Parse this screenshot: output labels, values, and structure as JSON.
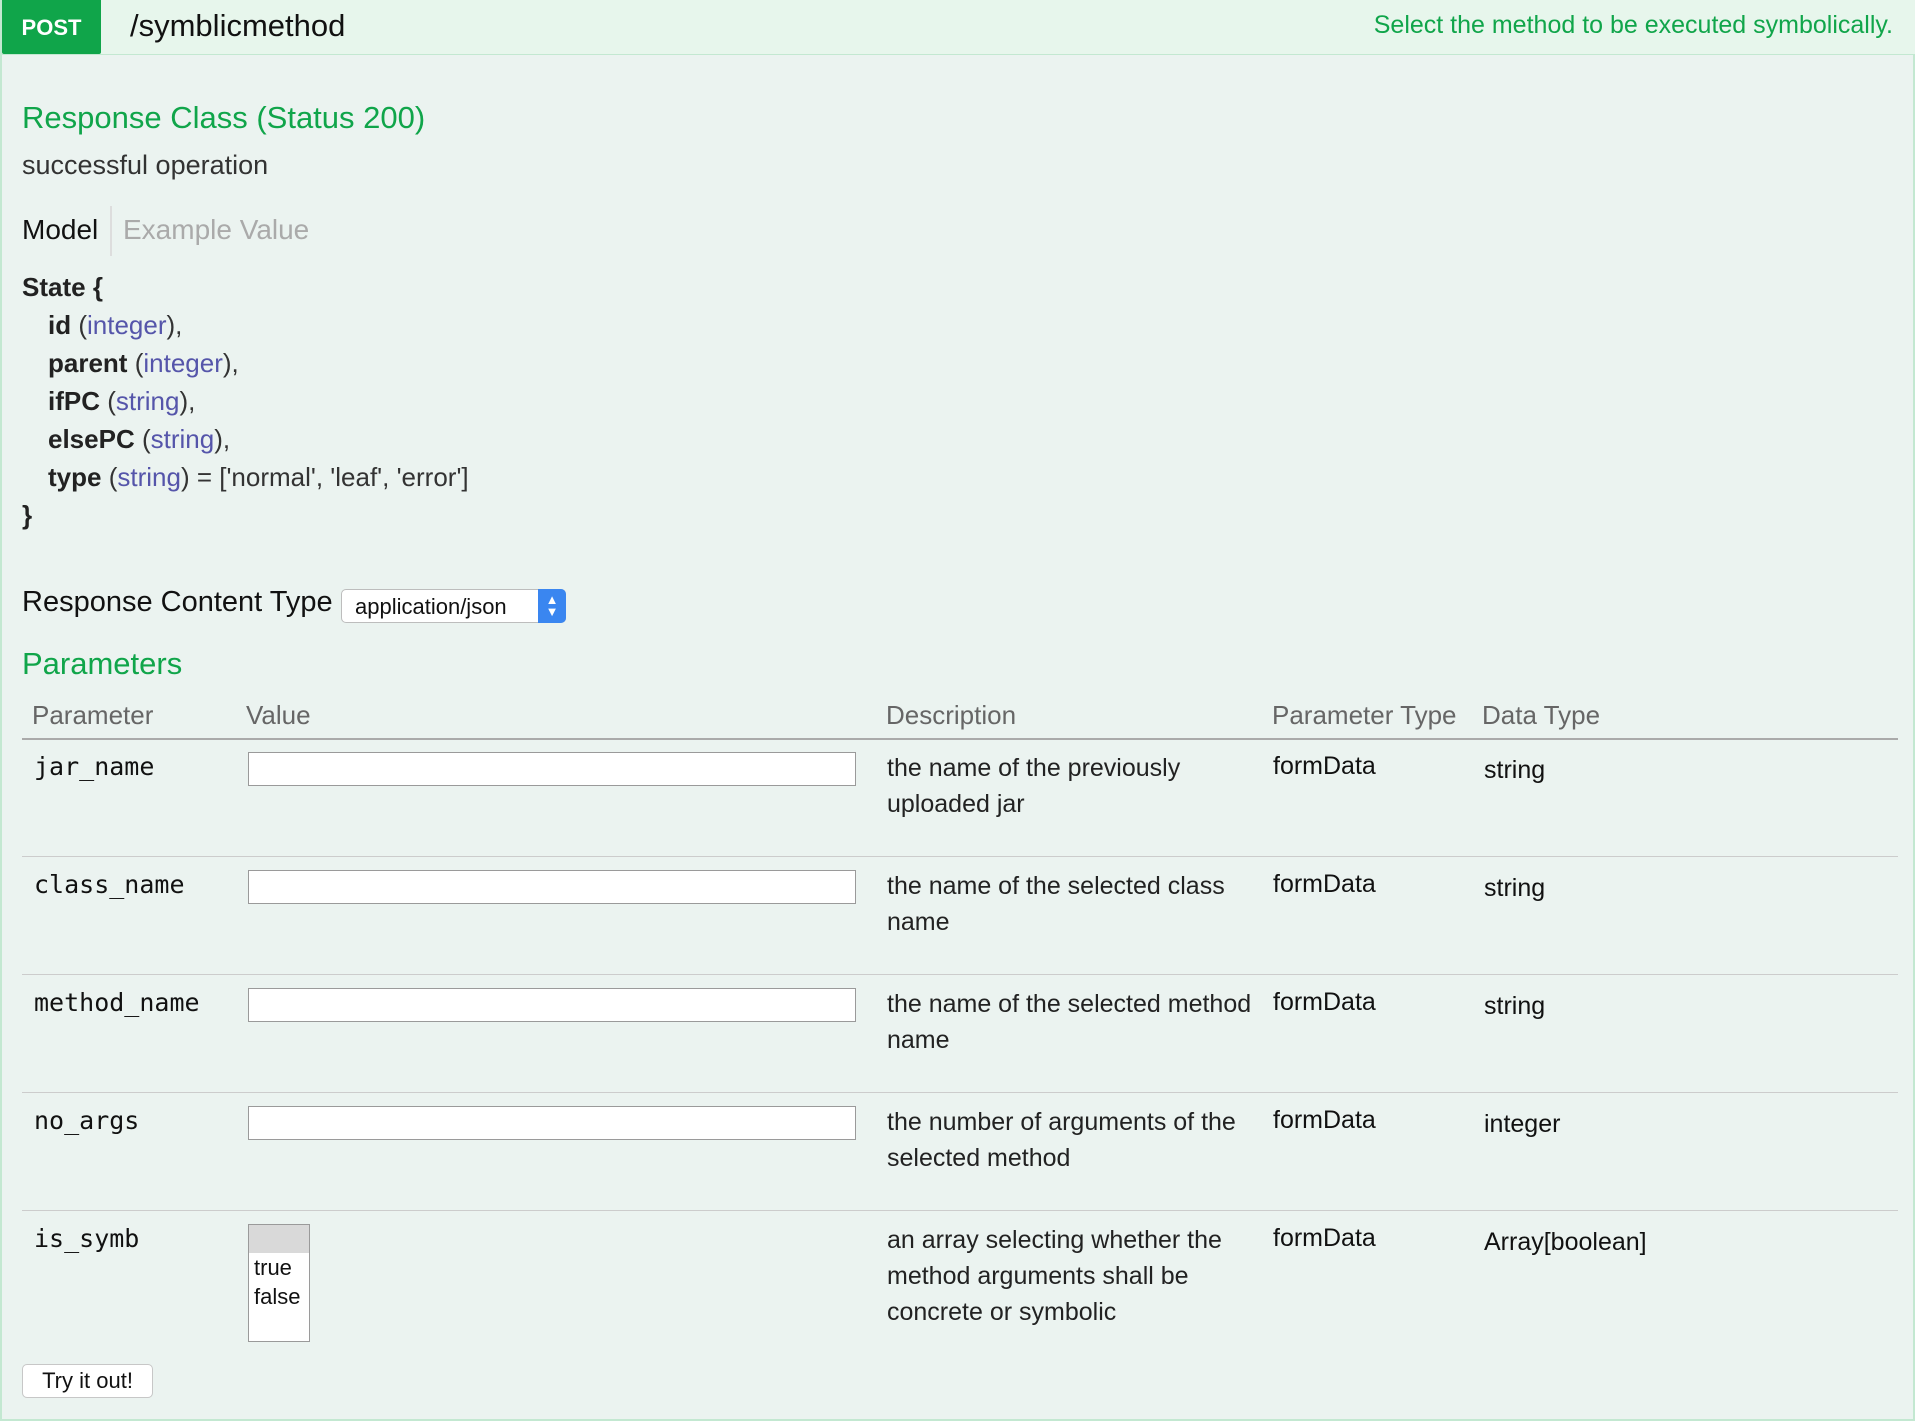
{
  "header": {
    "method": "POST",
    "path": "/symblicmethod",
    "summary": "Select the method to be executed symbolically."
  },
  "response": {
    "heading": "Response Class (Status 200)",
    "description": "successful operation",
    "tabs": [
      "Model",
      "Example Value"
    ],
    "active_tab": "Model",
    "model": {
      "name": "State",
      "open": "{",
      "close": "}",
      "fields": [
        {
          "name": "id",
          "type": "integer",
          "suffix": "),"
        },
        {
          "name": "parent",
          "type": "integer",
          "suffix": "),"
        },
        {
          "name": "ifPC",
          "type": "string",
          "suffix": "),"
        },
        {
          "name": "elsePC",
          "type": "string",
          "suffix": "),"
        },
        {
          "name": "type",
          "type": "string",
          "suffix": ") = ['normal', 'leaf', 'error']"
        }
      ]
    }
  },
  "content_type": {
    "label": "Response Content Type",
    "selected": "application/json"
  },
  "parameters": {
    "heading": "Parameters",
    "columns": [
      "Parameter",
      "Value",
      "Description",
      "Parameter Type",
      "Data Type"
    ],
    "rows": [
      {
        "name": "jar_name",
        "value": "",
        "description": "the name of the previously uploaded jar",
        "param_type": "formData",
        "data_type": "string"
      },
      {
        "name": "class_name",
        "value": "",
        "description": "the name of the selected class name",
        "param_type": "formData",
        "data_type": "string"
      },
      {
        "name": "method_name",
        "value": "",
        "description": "the name of the selected method name",
        "param_type": "formData",
        "data_type": "string"
      },
      {
        "name": "no_args",
        "value": "",
        "description": "the number of arguments of the selected method",
        "param_type": "formData",
        "data_type": "integer"
      },
      {
        "name": "is_symb",
        "options": [
          "true",
          "false"
        ],
        "description": "an array selecting whether the method arguments shall be concrete or symbolic",
        "param_type": "formData",
        "data_type": "Array[boolean]"
      }
    ]
  },
  "actions": {
    "try_label": "Try it out!"
  },
  "colors": {
    "accent": "#10a54a",
    "panel_bg": "#ebf3f0",
    "type_color": "#5555aa",
    "select_accent": "#3a86f0"
  }
}
